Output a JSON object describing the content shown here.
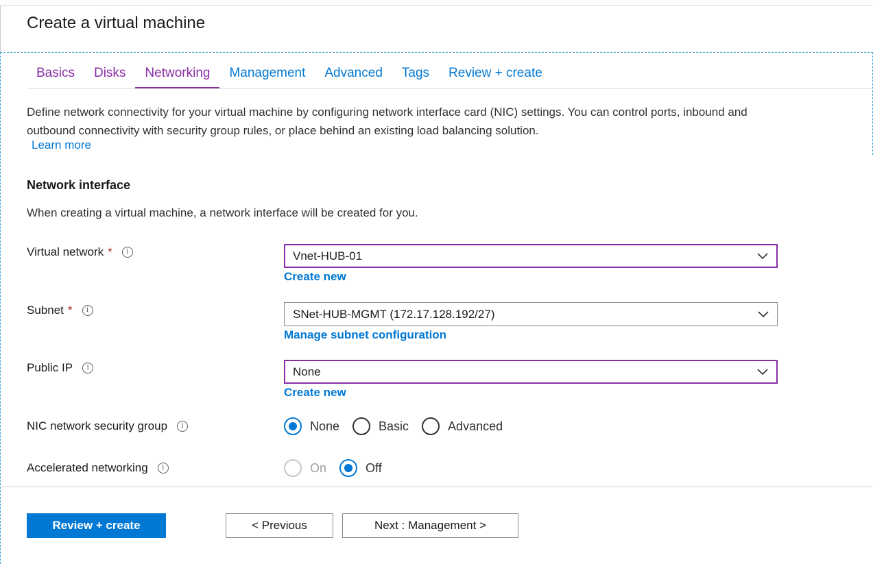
{
  "title": "Create a virtual machine",
  "tabs": [
    {
      "label": "Basics"
    },
    {
      "label": "Disks"
    },
    {
      "label": "Networking"
    },
    {
      "label": "Management"
    },
    {
      "label": "Advanced"
    },
    {
      "label": "Tags"
    },
    {
      "label": "Review + create"
    }
  ],
  "description": "Define network connectivity for your virtual machine by configuring network interface card (NIC) settings. You can control ports, inbound and outbound connectivity with security group rules, or place behind an existing load balancing solution.",
  "learn_more": "Learn more",
  "section": {
    "title": "Network interface",
    "description": "When creating a virtual machine, a network interface will be created for you."
  },
  "fields": {
    "virtual_network": {
      "label": "Virtual network",
      "required": "*",
      "value": "Vnet-HUB-01",
      "link": "Create new"
    },
    "subnet": {
      "label": "Subnet",
      "required": "*",
      "value": "SNet-HUB-MGMT (172.17.128.192/27)",
      "link": "Manage subnet configuration"
    },
    "public_ip": {
      "label": "Public IP",
      "value": "None",
      "link": "Create new"
    },
    "nic_nsg": {
      "label": "NIC network security group",
      "options": [
        "None",
        "Basic",
        "Advanced"
      ],
      "selected": "None"
    },
    "accelerated": {
      "label": "Accelerated networking",
      "options": [
        "On",
        "Off"
      ],
      "selected": "Off"
    }
  },
  "info_glyph": "i",
  "buttons": {
    "review_create": "Review + create",
    "previous": "< Previous",
    "next": "Next : Management >"
  },
  "colors": {
    "accent": "#0078d4",
    "visited": "#8a2da5",
    "required": "#a4262c"
  }
}
